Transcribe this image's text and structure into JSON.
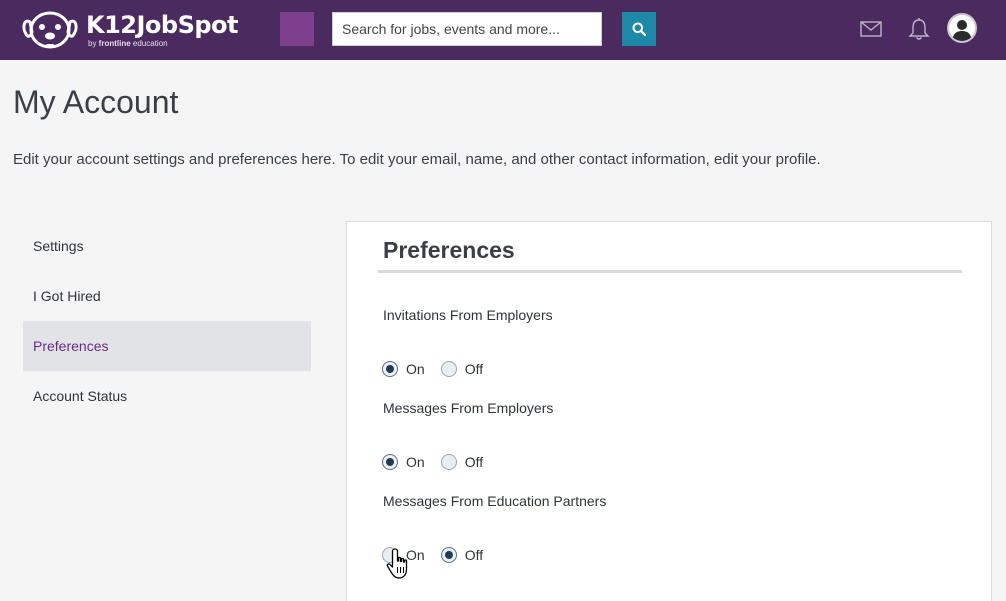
{
  "header": {
    "logo_text": "K12JobSpot",
    "logo_sub_prefix": "by ",
    "logo_sub_brand": "frontline",
    "logo_sub_suffix": " education",
    "search_placeholder": "Search for jobs, events and more...",
    "search_icon": "search-icon",
    "mail_icon": "envelope-icon",
    "bell_icon": "bell-icon",
    "colors": {
      "bar": "#4b2a5f",
      "accent_square": "#7e3f8f",
      "search_button": "#1e88a8"
    }
  },
  "page": {
    "title": "My Account",
    "description": "Edit your account settings and preferences here. To edit your email, name, and other contact information, edit your profile."
  },
  "sidebar": {
    "items": [
      {
        "label": "Settings",
        "active": false
      },
      {
        "label": "I Got Hired",
        "active": false
      },
      {
        "label": "Preferences",
        "active": true
      },
      {
        "label": "Account Status",
        "active": false
      }
    ],
    "active_color": "#6a2c7f"
  },
  "preferences": {
    "title": "Preferences",
    "groups": [
      {
        "label": "Invitations From Employers",
        "on_label": "On",
        "off_label": "Off",
        "selected": "On"
      },
      {
        "label": "Messages From Employers",
        "on_label": "On",
        "off_label": "Off",
        "selected": "On"
      },
      {
        "label": "Messages From Education Partners",
        "on_label": "On",
        "off_label": "Off",
        "selected": "Off"
      }
    ]
  }
}
